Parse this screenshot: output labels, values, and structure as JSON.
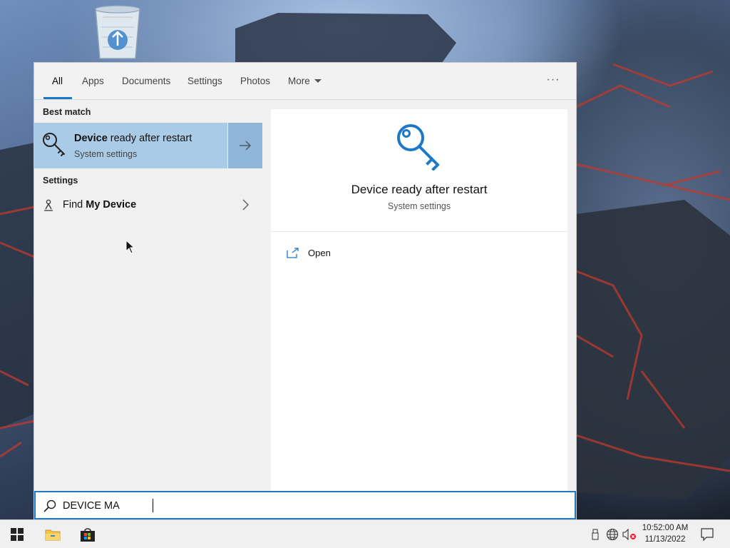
{
  "colors": {
    "accent": "#1e78c8",
    "selected_bg": "#a9cbe6",
    "selected_arrow_bg": "#8fb6d8"
  },
  "tabs": [
    {
      "label": "All",
      "active": true
    },
    {
      "label": "Apps"
    },
    {
      "label": "Documents"
    },
    {
      "label": "Settings"
    },
    {
      "label": "Photos"
    },
    {
      "label": "More"
    }
  ],
  "tabbar": {
    "ellipsis": "···"
  },
  "left_pane": {
    "best_match_label": "Best match",
    "best_match": {
      "title_bold": "Device",
      "title_rest": " ready after restart",
      "subtitle": "System settings",
      "icon": "key-icon"
    },
    "settings_label": "Settings",
    "settings_items": [
      {
        "label_pre": "Find ",
        "label_bold": "My Device",
        "icon": "person-location-icon"
      }
    ]
  },
  "preview": {
    "title": "Device ready after restart",
    "subtitle": "System settings",
    "icon": "key-icon",
    "actions": [
      {
        "label": "Open",
        "icon": "open-external-icon"
      }
    ]
  },
  "search": {
    "value": "DEVICE MA",
    "icon": "search-icon"
  },
  "taskbar": {
    "clock_time": "10:52:00 AM",
    "clock_date": "11/13/2022"
  }
}
